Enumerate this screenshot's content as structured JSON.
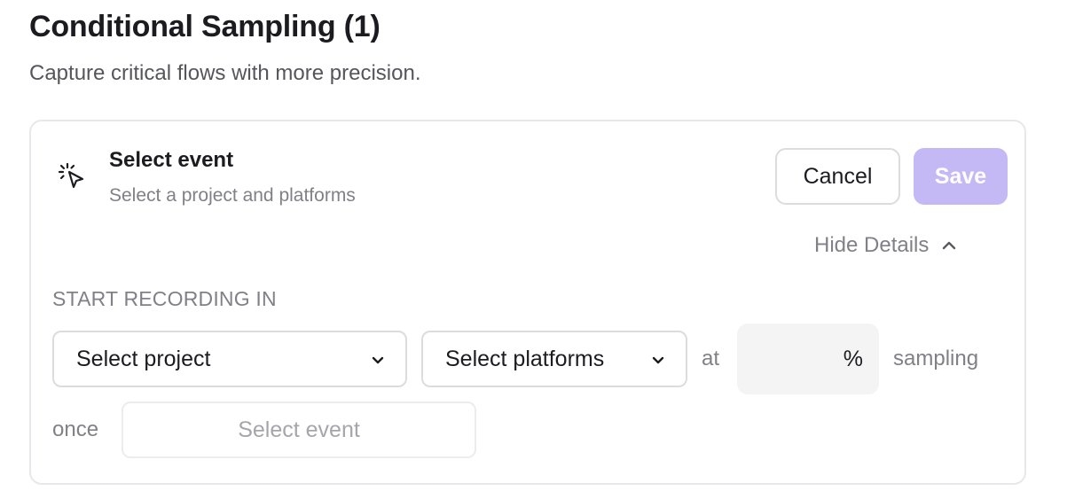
{
  "header": {
    "title": "Conditional Sampling (1)",
    "subtitle": "Capture critical flows with more precision."
  },
  "card": {
    "icon": "cursor-click-icon",
    "heading": "Select event",
    "subheading": "Select a project and platforms",
    "cancel_label": "Cancel",
    "save_label": "Save",
    "toggle_details_label": "Hide Details",
    "section_label": "START RECORDING IN",
    "project_select": {
      "value": "Select project"
    },
    "platforms_select": {
      "value": "Select platforms"
    },
    "at_label": "at",
    "percent_input": {
      "value": "",
      "suffix": "%"
    },
    "sampling_label": "sampling",
    "once_label": "once",
    "event_select": {
      "placeholder": "Select event"
    }
  },
  "colors": {
    "save_button_disabled": "#c4b8f5",
    "muted_text": "#808087",
    "border": "#dcdce0"
  }
}
